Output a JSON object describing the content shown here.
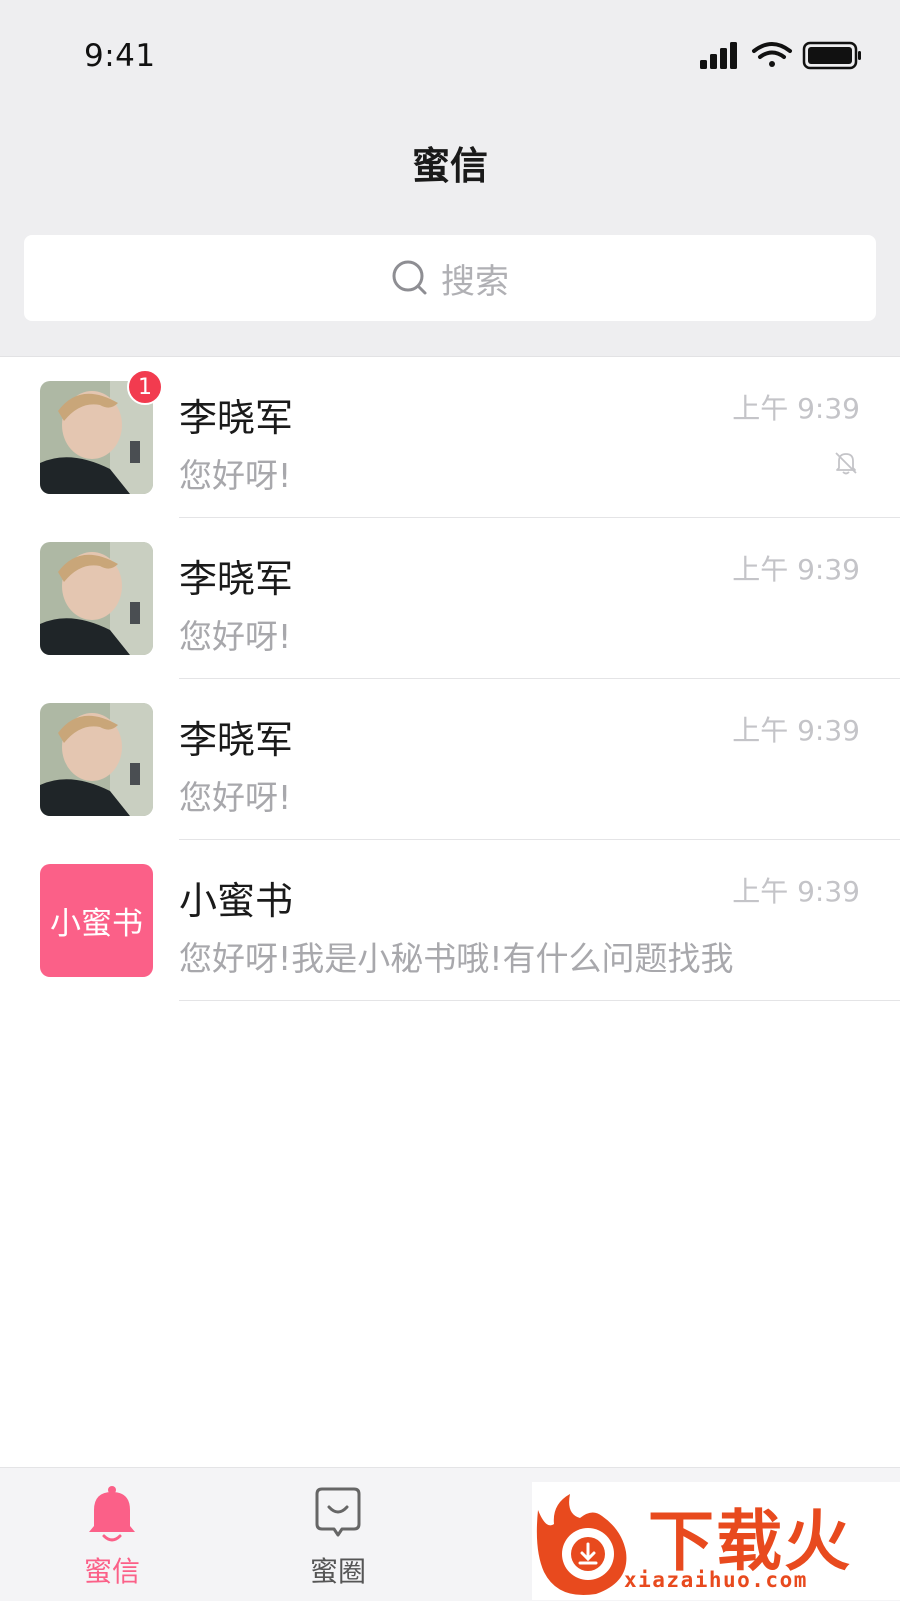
{
  "status_bar": {
    "time": "9:41"
  },
  "nav": {
    "title": "蜜信"
  },
  "search": {
    "placeholder": "搜索"
  },
  "conversations": [
    {
      "name": "李晓军",
      "time": "上午 9:39",
      "preview": "您好呀!",
      "badge": "1",
      "muted": true,
      "avatar_icon": "user-photo"
    },
    {
      "name": "李晓军",
      "time": "上午 9:39",
      "preview": "您好呀!",
      "avatar_icon": "user-photo"
    },
    {
      "name": "李晓军",
      "time": "上午 9:39",
      "preview": "您好呀!",
      "avatar_icon": "user-photo"
    },
    {
      "name": "小蜜书",
      "time": "上午 9:39",
      "preview": "您好呀!我是小秘书哦!有什么问题找我",
      "avatar_text": "小蜜书",
      "avatar_color": "#fb6088"
    }
  ],
  "tabbar": {
    "tabs": [
      {
        "label": "蜜信",
        "icon": "bell-icon",
        "active": true
      },
      {
        "label": "蜜圈",
        "icon": "chat-bubble-icon",
        "active": false
      }
    ]
  },
  "watermark": {
    "text": "下载火",
    "url": "xiazaihuo.com"
  },
  "colors": {
    "accent": "#fb6088",
    "badge": "#f23b4f",
    "watermark": "#e84a1e"
  }
}
